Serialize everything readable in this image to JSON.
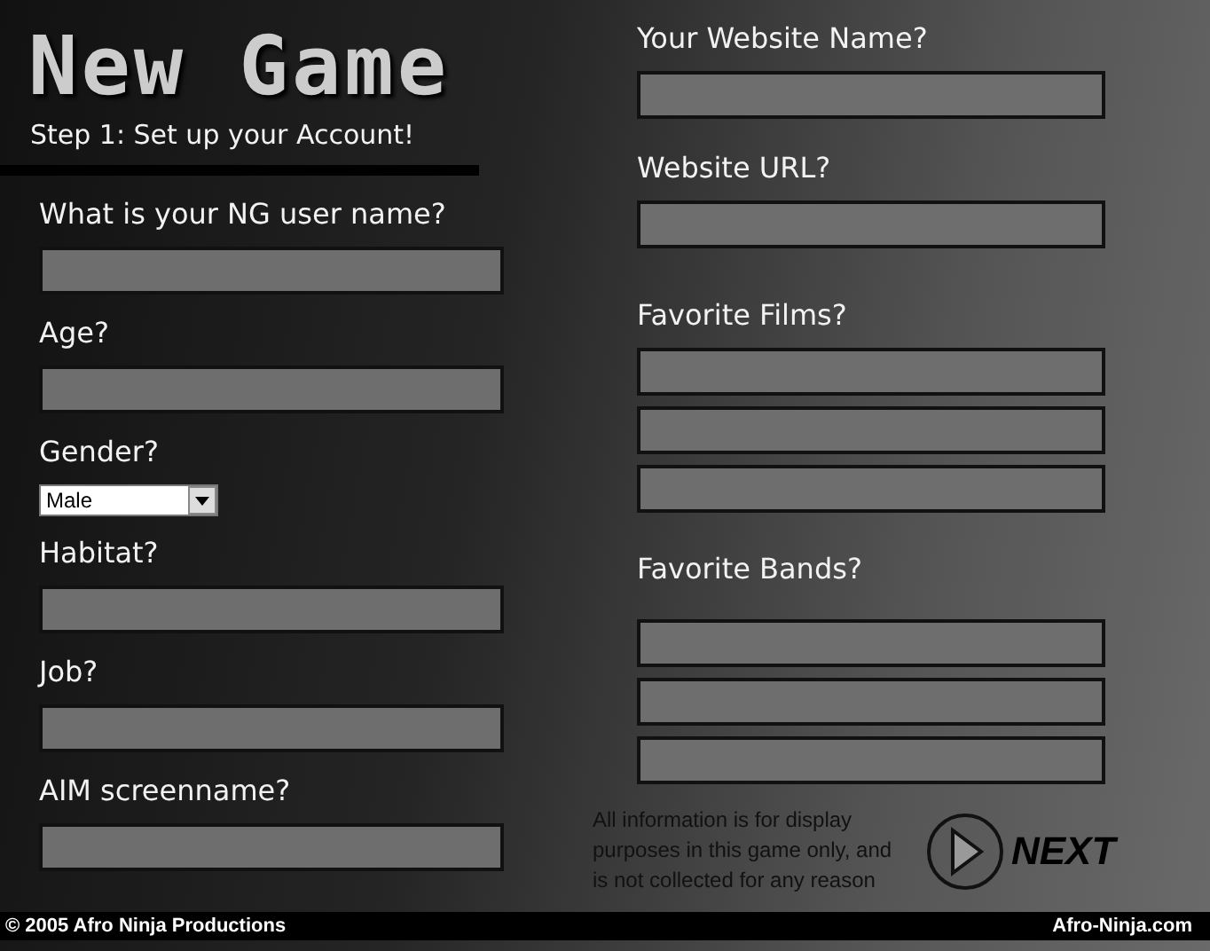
{
  "header": {
    "title": "New Game",
    "subtitle": "Step 1: Set up your Account!"
  },
  "left_questions": [
    {
      "label": "What is your NG user name?",
      "kind": "text"
    },
    {
      "label": "Age?",
      "kind": "text"
    },
    {
      "label": "Gender?",
      "kind": "select",
      "value": "Male"
    },
    {
      "label": "Habitat?",
      "kind": "text"
    },
    {
      "label": "Job?",
      "kind": "text"
    },
    {
      "label": "AIM screenname?",
      "kind": "text"
    }
  ],
  "right_questions": [
    {
      "label": "Your Website Name?",
      "fields": [
        {
          "kind": "text"
        }
      ]
    },
    {
      "label": "Website URL?",
      "fields": [
        {
          "kind": "text"
        }
      ]
    },
    {
      "label": "Favorite Films?",
      "fields": [
        {
          "kind": "text"
        },
        {
          "kind": "text"
        },
        {
          "kind": "text"
        }
      ]
    },
    {
      "label": "Favorite Bands?",
      "fields": [
        {
          "kind": "text"
        },
        {
          "kind": "text"
        },
        {
          "kind": "text"
        }
      ]
    }
  ],
  "notice": "All information is for display purposes in this game only, and is not collected for any reason",
  "next_button": "NEXT",
  "footer": {
    "copyright": "© 2005 Afro Ninja Productions",
    "site": "Afro-Ninja.com"
  }
}
